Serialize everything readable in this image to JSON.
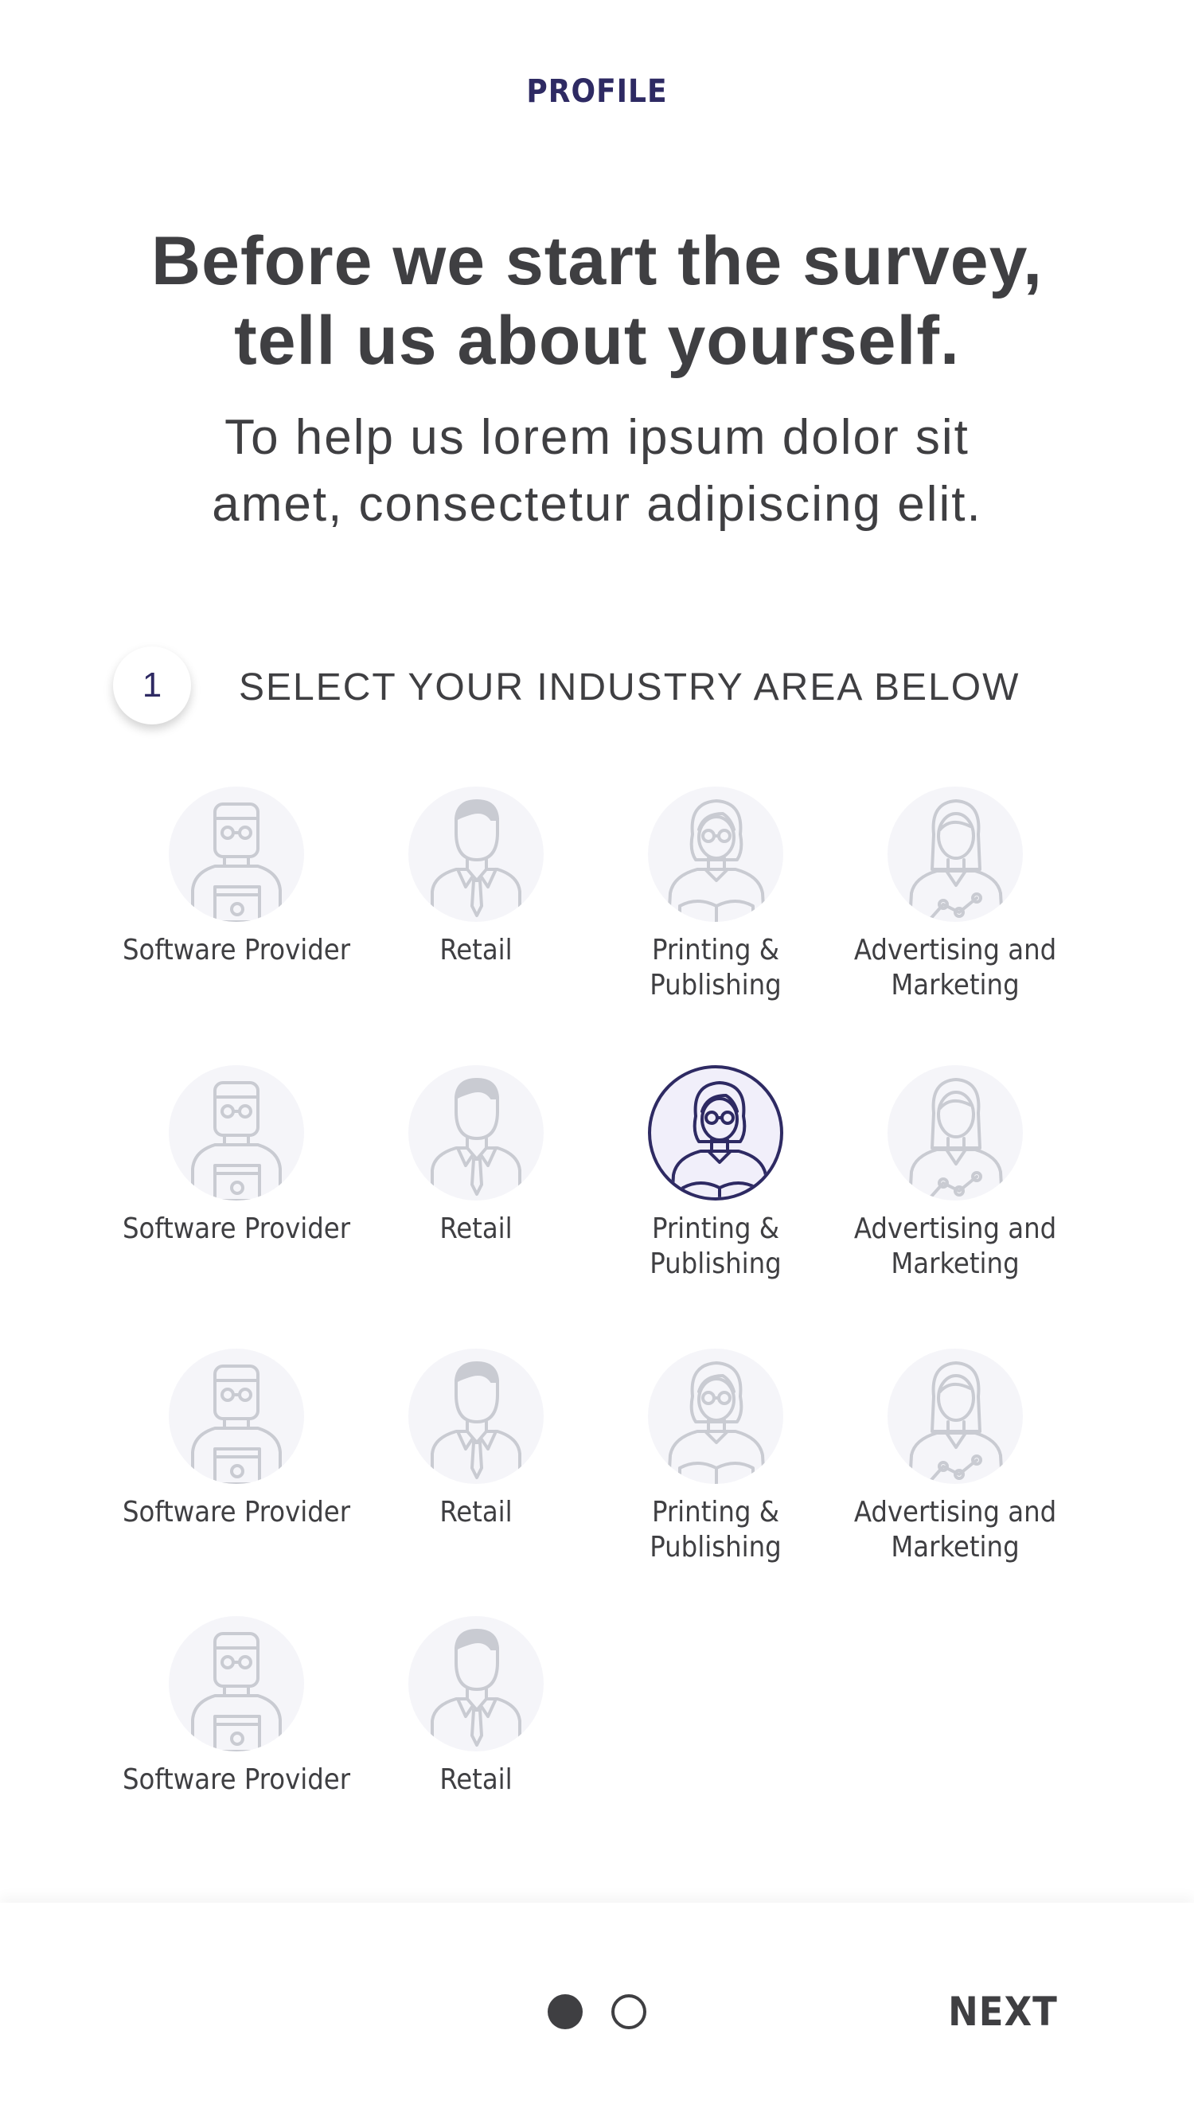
{
  "header": {
    "title": "PROFILE"
  },
  "intro": {
    "headline_line1": "Before we start the survey,",
    "headline_line2": "tell us about yourself.",
    "subhead_line1": "To help us lorem ipsum dolor sit",
    "subhead_line2": "amet, consectetur adipiscing elit."
  },
  "step": {
    "number": "1",
    "label": "SELECT YOUR INDUSTRY AREA BELOW"
  },
  "industries": [
    {
      "line1": "Software Provider",
      "line2": "",
      "icon": "software-provider-avatar-icon",
      "selected": false
    },
    {
      "line1": "Retail",
      "line2": "",
      "icon": "retail-avatar-icon",
      "selected": false
    },
    {
      "line1": "Printing &",
      "line2": "Publishing",
      "icon": "printing-publishing-avatar-icon",
      "selected": false
    },
    {
      "line1": "Advertising and",
      "line2": "Marketing",
      "icon": "advertising-marketing-avatar-icon",
      "selected": false
    },
    {
      "line1": "Software Provider",
      "line2": "",
      "icon": "software-provider-avatar-icon",
      "selected": false
    },
    {
      "line1": "Retail",
      "line2": "",
      "icon": "retail-avatar-icon",
      "selected": false
    },
    {
      "line1": "Printing &",
      "line2": "Publishing",
      "icon": "printing-publishing-avatar-icon",
      "selected": true
    },
    {
      "line1": "Advertising and",
      "line2": "Marketing",
      "icon": "advertising-marketing-avatar-icon",
      "selected": false
    },
    {
      "line1": "Software Provider",
      "line2": "",
      "icon": "software-provider-avatar-icon",
      "selected": false
    },
    {
      "line1": "Retail",
      "line2": "",
      "icon": "retail-avatar-icon",
      "selected": false
    },
    {
      "line1": "Printing &",
      "line2": "Publishing",
      "icon": "printing-publishing-avatar-icon",
      "selected": false
    },
    {
      "line1": "Advertising and",
      "line2": "Marketing",
      "icon": "advertising-marketing-avatar-icon",
      "selected": false
    },
    {
      "line1": "Software Provider",
      "line2": "",
      "icon": "software-provider-avatar-icon",
      "selected": false
    },
    {
      "line1": "Retail",
      "line2": "",
      "icon": "retail-avatar-icon",
      "selected": false
    }
  ],
  "footer": {
    "pagination": {
      "current": 1,
      "total": 2
    },
    "next_label": "NEXT"
  },
  "colors": {
    "accent": "#2e2a63",
    "text": "#3f3f42",
    "icon_inactive": "#c9cbd2",
    "avatar_bg": "#f5f5f9"
  }
}
